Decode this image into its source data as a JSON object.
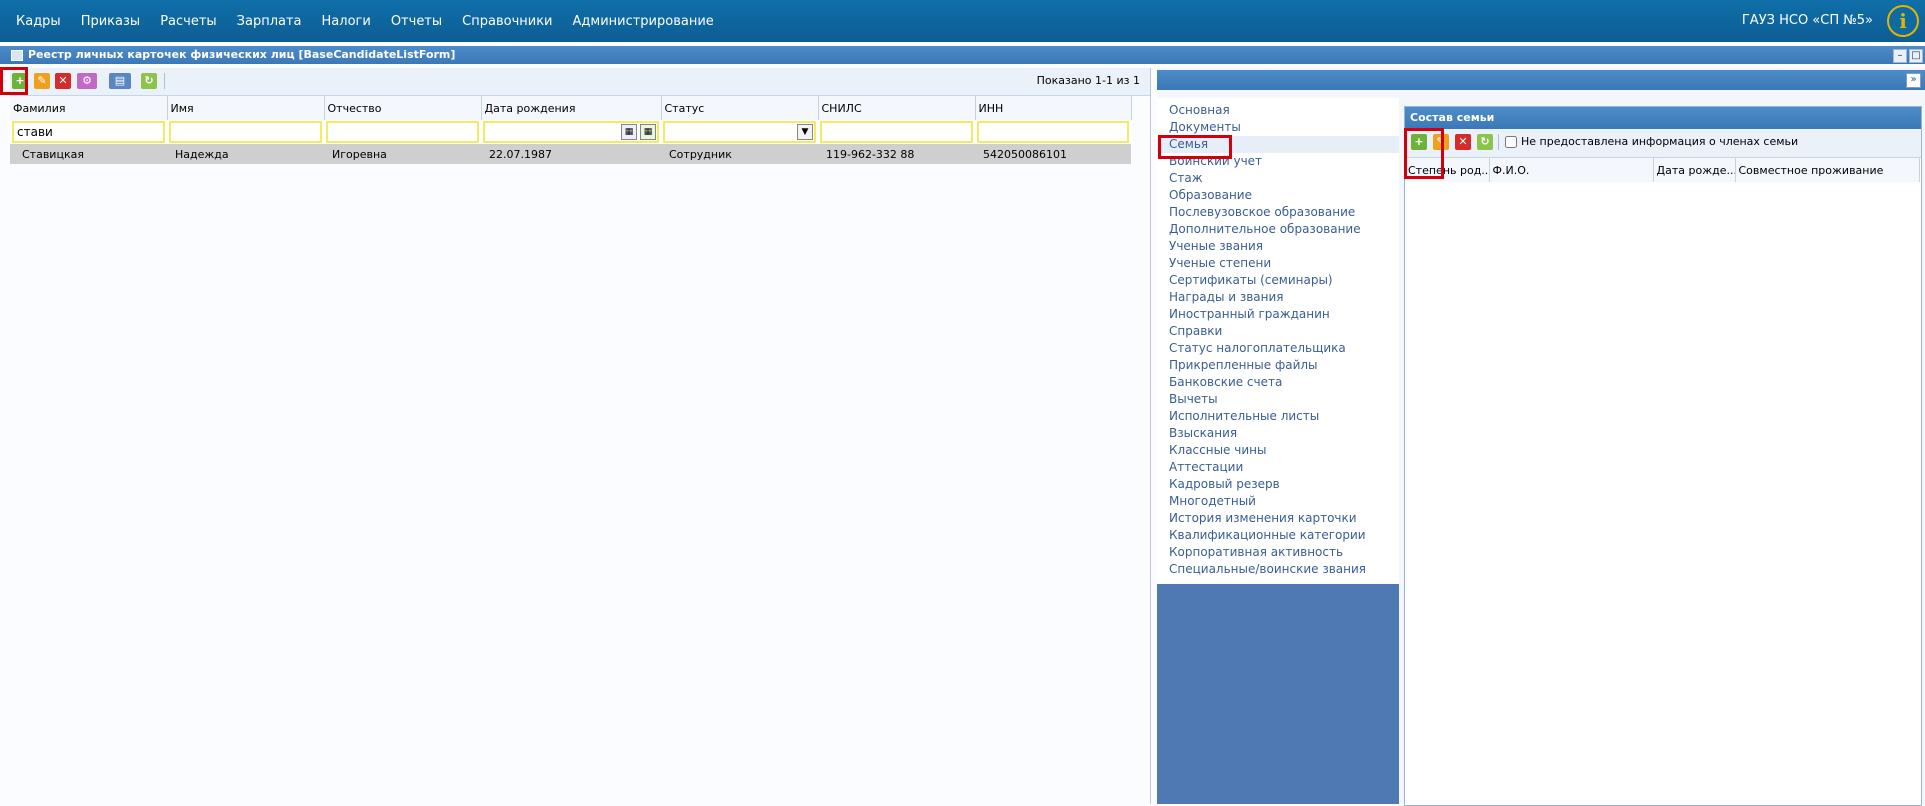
{
  "menu": [
    "Кадры",
    "Приказы",
    "Расчеты",
    "Зарплата",
    "Налоги",
    "Отчеты",
    "Справочники",
    "Администрирование"
  ],
  "org": "ГАУЗ НСО «СП №5»",
  "form_title": "Реестр личных карточек физических лиц [BaseCandidateListForm]",
  "shown": "Показано 1-1 из 1",
  "columns": [
    "Фамилия",
    "Имя",
    "Отчество",
    "Дата рождения",
    "Статус",
    "СНИЛС",
    "ИНН"
  ],
  "filter": {
    "surname": "стави"
  },
  "row": {
    "surname": "Ставицкая",
    "name": "Надежда",
    "patronymic": "Игоревна",
    "birth": "22.07.1987",
    "status": "Сотрудник",
    "snils": "119-962-332 88",
    "inn": "542050086101"
  },
  "tabs": [
    "Основная",
    "Документы",
    "Семья",
    "Воинский учет",
    "Стаж",
    "Образование",
    "Послевузовское образование",
    "Дополнительное образование",
    "Ученые звания",
    "Ученые степени",
    "Сертификаты (семинары)",
    "Награды и звания",
    "Иностранный гражданин",
    "Справки",
    "Статус налогоплательщика",
    "Прикрепленные файлы",
    "Банковские счета",
    "Вычеты",
    "Исполнительные листы",
    "Взыскания",
    "Классные чины",
    "Аттестации",
    "Кадровый резерв",
    "Многодетный",
    "История изменения карточки",
    "Квалификационные категории",
    "Корпоративная активность",
    "Специальные/воинские звания"
  ],
  "family": {
    "title": "Состав семьи",
    "no_info_label": "Не предоставлена информация о членах семьи",
    "columns": [
      "Степень род...",
      "Ф.И.О.",
      "Дата рожде...",
      "Совместное проживание"
    ]
  },
  "colors": {
    "menu_bg": "#0f6fa9",
    "panel_header": "#3b78b7",
    "tab_list_bg": "#4f79b3",
    "highlight": "#d3000c"
  }
}
